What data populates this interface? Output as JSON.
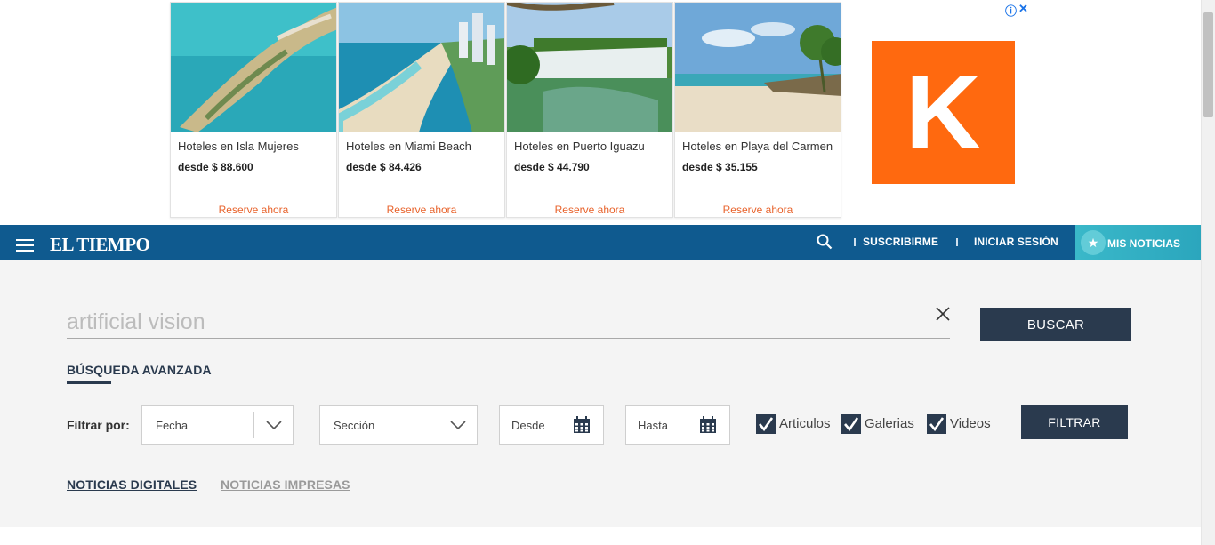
{
  "ads": [
    {
      "title": "Hoteles en Isla Mujeres",
      "price": "desde $ 88.600",
      "cta": "Reserve ahora"
    },
    {
      "title": "Hoteles en Miami Beach",
      "price": "desde $ 84.426",
      "cta": "Reserve ahora"
    },
    {
      "title": "Hoteles en Puerto Iguazu",
      "price": "desde $ 44.790",
      "cta": "Reserve ahora"
    },
    {
      "title": "Hoteles en Playa del Carmen",
      "price": "desde $ 35.155",
      "cta": "Reserve ahora"
    }
  ],
  "ad_brand": {
    "letter": "K",
    "color": "#ff690f"
  },
  "ad_choices": {
    "info_icon": "ⓘ",
    "close_icon": "✕"
  },
  "nav": {
    "logo": "EL TIEMPO",
    "subscribe": "SUSCRIBIRME",
    "login": "INICIAR SESIÓN",
    "mis_noticias": "MIS NOTICIAS",
    "bg_color": "#0f5a8f"
  },
  "search": {
    "query": "artificial vision",
    "button": "BUSCAR",
    "advanced": "BÚSQUEDA AVANZADA"
  },
  "filters": {
    "label": "Filtrar por:",
    "fecha": "Fecha",
    "seccion": "Sección",
    "desde": "Desde",
    "hasta": "Hasta",
    "checkboxes": [
      {
        "label": "Articulos",
        "checked": true
      },
      {
        "label": "Galerias",
        "checked": true
      },
      {
        "label": "Videos",
        "checked": true
      }
    ],
    "button": "FILTRAR"
  },
  "tabs": [
    {
      "label": "NOTICIAS DIGITALES",
      "active": true
    },
    {
      "label": "NOTICIAS IMPRESAS",
      "active": false
    }
  ]
}
